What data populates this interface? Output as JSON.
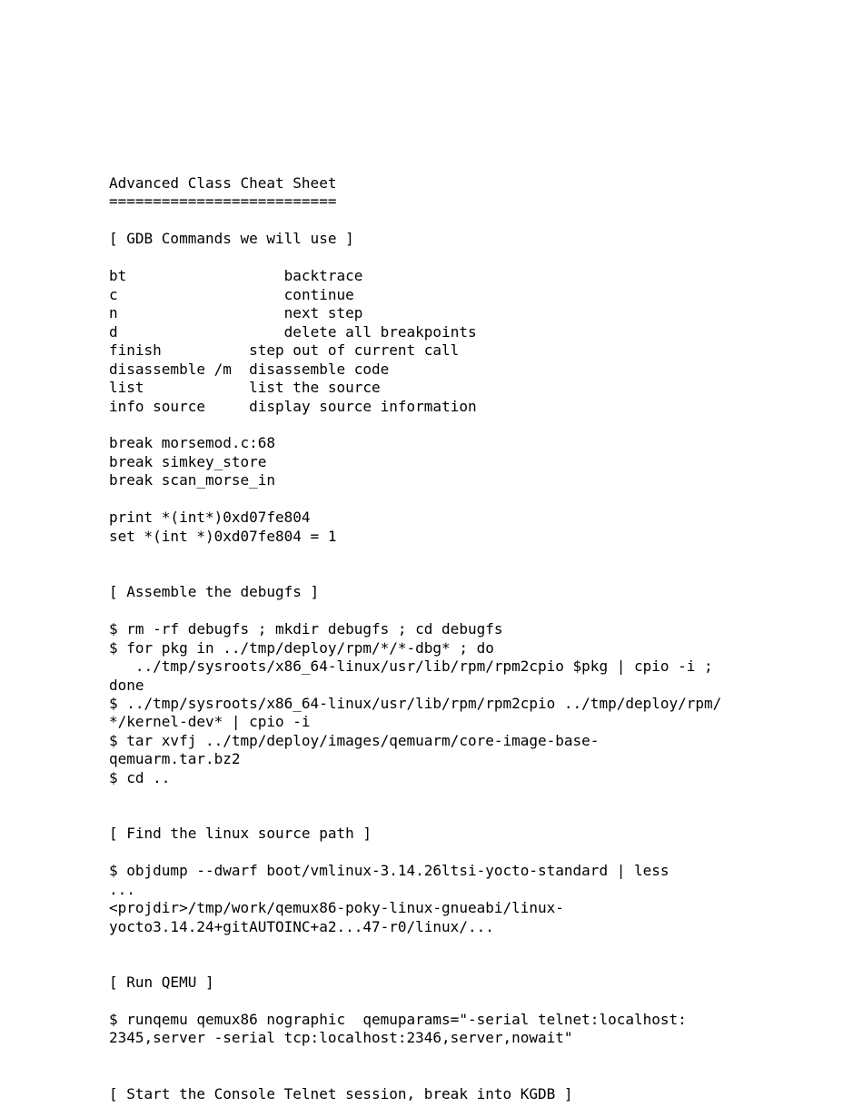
{
  "title": "Advanced Class Cheat Sheet",
  "title_rule": "==========================",
  "sections": {
    "gdb_header": "[ GDB Commands we will use ]",
    "gdb_rows": [
      {
        "cmd": "bt",
        "pad": "                  ",
        "desc": "backtrace"
      },
      {
        "cmd": "c",
        "pad": "                   ",
        "desc": "continue"
      },
      {
        "cmd": "n",
        "pad": "                   ",
        "desc": "next step"
      },
      {
        "cmd": "d",
        "pad": "                   ",
        "desc": "delete all breakpoints"
      },
      {
        "cmd": "finish",
        "pad": "          ",
        "desc": "step out of current call"
      },
      {
        "cmd": "disassemble /m",
        "pad": "  ",
        "desc": "disassemble code"
      },
      {
        "cmd": "list",
        "pad": "            ",
        "desc": "list the source"
      },
      {
        "cmd": "info source",
        "pad": "     ",
        "desc": "display source information"
      }
    ],
    "break_lines": [
      "break morsemod.c:68",
      "break simkey_store",
      "break scan_morse_in"
    ],
    "print_lines": [
      "print *(int*)0xd07fe804",
      "set *(int *)0xd07fe804 = 1"
    ],
    "assemble_header": "[ Assemble the debugfs ]",
    "assemble_lines": [
      "$ rm -rf debugfs ; mkdir debugfs ; cd debugfs",
      "$ for pkg in ../tmp/deploy/rpm/*/*-dbg* ; do",
      "   ../tmp/sysroots/x86_64-linux/usr/lib/rpm/rpm2cpio $pkg | cpio -i ;",
      "done",
      "$ ../tmp/sysroots/x86_64-linux/usr/lib/rpm/rpm2cpio ../tmp/deploy/rpm/",
      "*/kernel-dev* | cpio -i",
      "$ tar xvfj ../tmp/deploy/images/qemuarm/core-image-base-",
      "qemuarm.tar.bz2",
      "$ cd .."
    ],
    "find_header": "[ Find the linux source path ]",
    "find_lines": [
      "$ objdump --dwarf boot/vmlinux-3.14.26ltsi-yocto-standard | less",
      "...",
      "<projdir>/tmp/work/qemux86-poky-linux-gnueabi/linux-",
      "yocto3.14.24+gitAUTOINC+a2...47-r0/linux/..."
    ],
    "qemu_header": "[ Run QEMU ]",
    "qemu_lines": [
      "$ runqemu qemux86 nographic  qemuparams=\"-serial telnet:localhost:",
      "2345,server -serial tcp:localhost:2346,server,nowait\""
    ],
    "telnet_header": "[ Start the Console Telnet session, break into KGDB ]"
  }
}
